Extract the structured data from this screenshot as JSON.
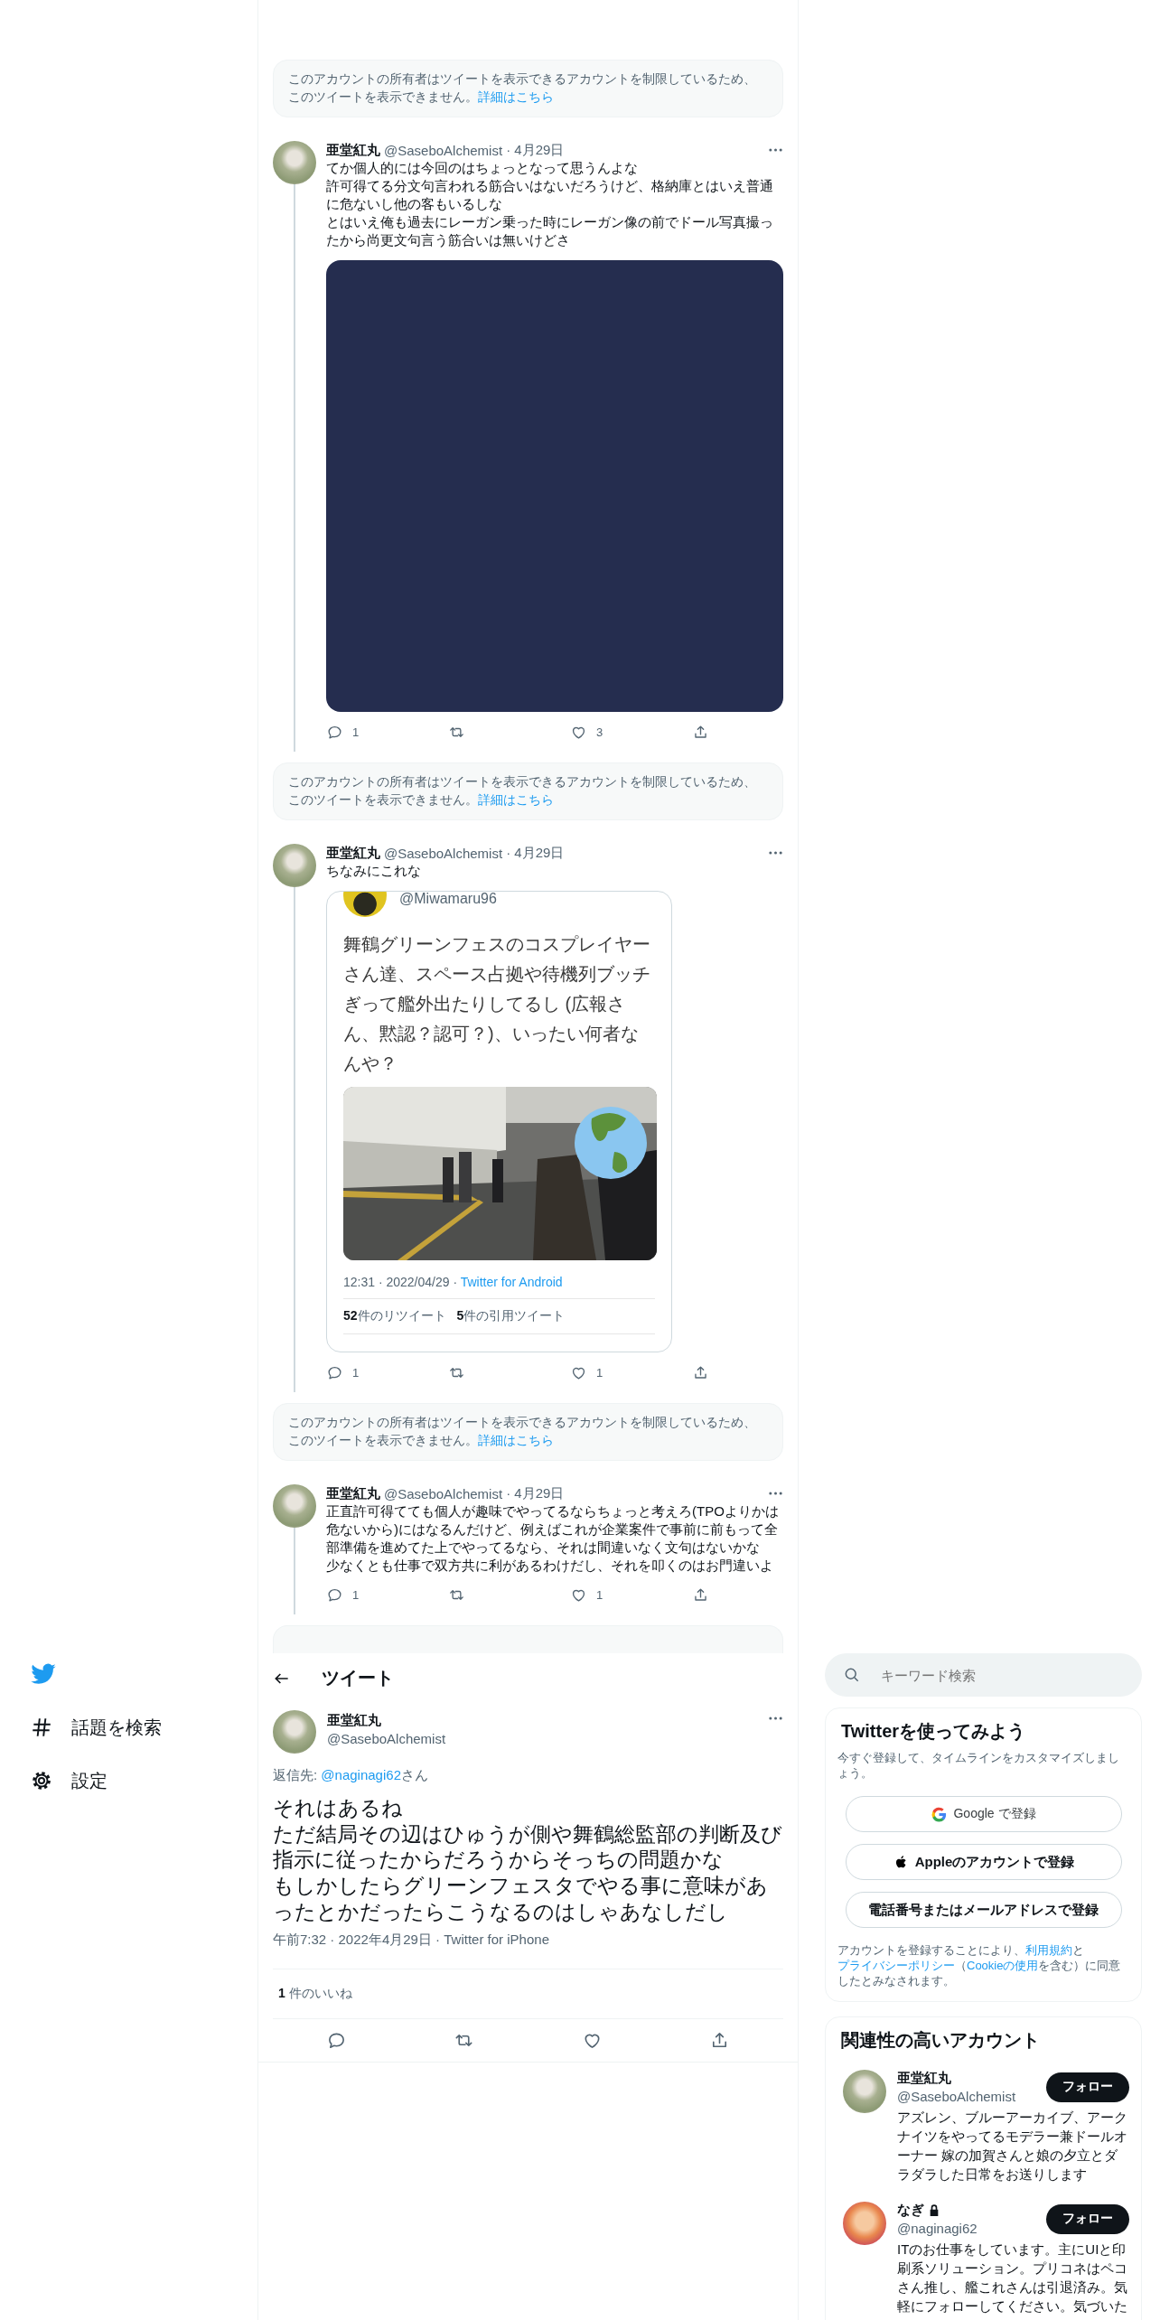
{
  "nav": {
    "items": [
      {
        "label": "話題を検索"
      },
      {
        "label": "設定"
      }
    ]
  },
  "thread": [
    {
      "kind": "notice",
      "text": "このアカウントの所有者はツイートを表示できるアカウントを制限しているため、このツイートを表示できません。",
      "link": "詳細はこちら"
    },
    {
      "kind": "tweet",
      "name": "亜堂紅丸",
      "handle": "@SaseboAlchemist",
      "date": "· 4月29日",
      "text": [
        "てか個人的には今回のはちょっとなって思うんよな",
        "許可得てる分文句言われる筋合いはないだろうけど、格納庫とはいえ普通に危ないし他の客もいるしな",
        "とはいえ俺も過去にレーガン乗った時にレーガン像の前でドール写真撮ったから尚更文句言う筋合いは無いけどさ"
      ],
      "media": {
        "kind": "placeholder"
      },
      "reply_count": "1",
      "like_count": "3"
    },
    {
      "kind": "notice",
      "text": "このアカウントの所有者はツイートを表示できるアカウントを制限しているため、このツイートを表示できません。",
      "link": "詳細はこちら"
    },
    {
      "kind": "tweet",
      "name": "亜堂紅丸",
      "handle": "@SaseboAlchemist",
      "date": "· 4月29日",
      "text": [
        "ちなみにこれな"
      ],
      "media": {
        "kind": "quote",
        "handle": "@Miwamaru96",
        "text": "舞鶴グリーンフェスのコスプレイヤーさん達、スペース占拠や待機列ブッチぎって艦外出たりしてるし (広報さん、黙認？認可？)、いったい何者なんや？",
        "time": "12:31 · 2022/04/29 · ",
        "source": "Twitter for Android",
        "stats": [
          {
            "count": "52",
            "label": "件のリツイート"
          },
          {
            "count": "5",
            "label": "件の引用ツイート"
          }
        ]
      },
      "reply_count": "1",
      "like_count": "1"
    },
    {
      "kind": "notice",
      "text": "このアカウントの所有者はツイートを表示できるアカウントを制限しているため、このツイートを表示できません。",
      "link": "詳細はこちら"
    },
    {
      "kind": "tweet",
      "name": "亜堂紅丸",
      "handle": "@SaseboAlchemist",
      "date": "· 4月29日",
      "text": [
        "正直許可得てても個人が趣味でやってるならちょっと考えろ(TPOよりかは危ないから)にはなるんだけど、例えばこれが企業案件で事前に前もって全部準備を進めてた上でやってるなら、それは間違いなく文句はないかな",
        "少なくとも仕事で双方共に利があるわけだし、それを叩くのはお門違いよ"
      ],
      "reply_count": "1",
      "like_count": "1"
    },
    {
      "kind": "cut_notice"
    }
  ],
  "detail": {
    "title": "ツイート",
    "name": "亜堂紅丸",
    "handle": "@SaseboAlchemist",
    "reply_label": "返信先: ",
    "reply_to": "@naginagi62",
    "reply_suffix": "さん",
    "text": [
      "それはあるね",
      "ただ結局その辺はひゅうが側や舞鶴総監部の判断及び指示に従ったからだろうからそっちの問題かな",
      "もしかしたらグリーンフェスタでやる事に意味があったとかだったらこうなるのはしゃあなしだし"
    ],
    "meta": "午前7:32 · 2022年4月29日 · Twitter for iPhone",
    "likes_count": "1",
    "likes_label": "件のいいね"
  },
  "sidebar": {
    "search": {
      "placeholder": "キーワード検索"
    },
    "signup": {
      "title": "Twitterを使ってみよう",
      "subtitle": "今すぐ登録して、タイムラインをカスタマイズしましょう。",
      "buttons": [
        {
          "label": "Google で登録"
        },
        {
          "label": "Appleのアカウントで登録"
        },
        {
          "label": "電話番号またはメールアドレスで登録"
        }
      ],
      "terms": [
        {
          "kind": "text",
          "text": "アカウントを登録することにより、"
        },
        {
          "kind": "link",
          "text": "利用規約"
        },
        {
          "kind": "text",
          "text": "と"
        },
        {
          "kind": "link",
          "text": "プライバシーポリシー"
        },
        {
          "kind": "text",
          "text": "（"
        },
        {
          "kind": "link",
          "text": "Cookieの使用"
        },
        {
          "kind": "text",
          "text": "を含む）に同意したとみなされます。"
        }
      ]
    },
    "related": {
      "title": "関連性の高いアカウント",
      "accounts": [
        {
          "name": "亜堂紅丸",
          "handle": "@SaseboAlchemist",
          "locked": false,
          "button": "フォロー",
          "bio": "アズレン、ブルーアーカイブ、アークナイツをやってるモデラー兼ドールオーナー 嫁の加賀さんと娘の夕立とダラダラした日常をお送りします"
        },
        {
          "name": "なぎ",
          "handle": "@naginagi62",
          "locked": true,
          "button": "フォロー",
          "bio": "ITのお仕事をしています。主にUIと印刷系ソリューション。プリコネはペコさん推し、艦これさんは引退済み。気軽にフォローしてください。気づいた"
        }
      ]
    }
  }
}
